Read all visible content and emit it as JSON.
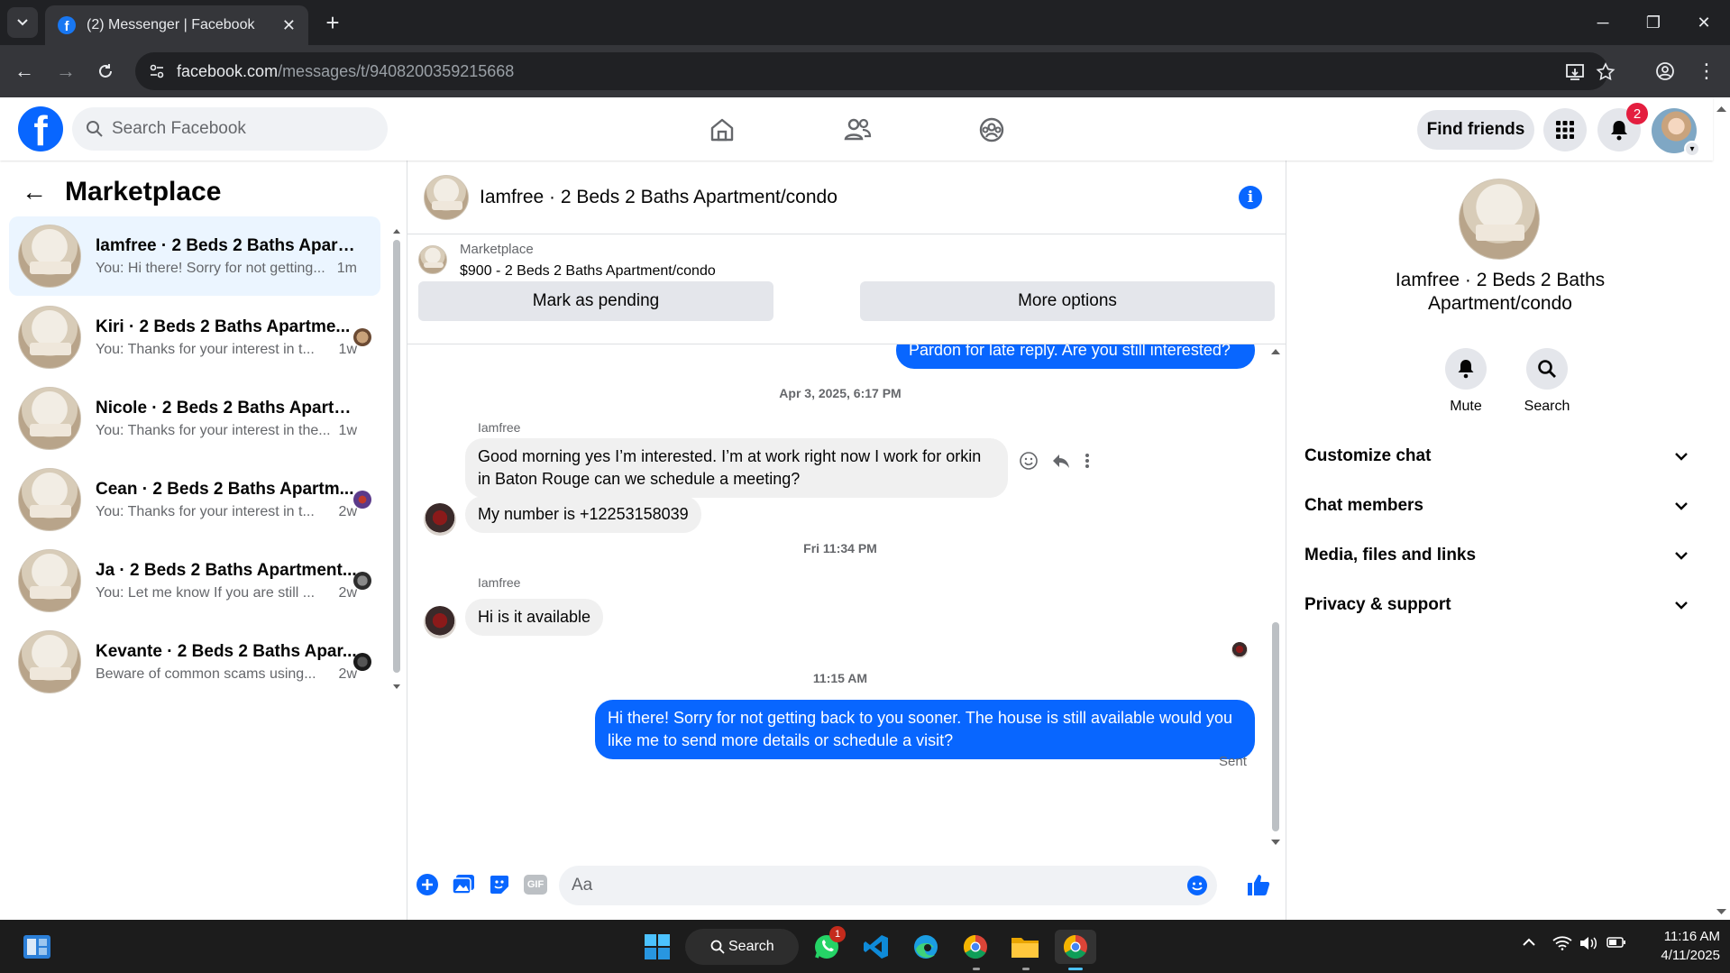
{
  "browser": {
    "tab_title": "(2) Messenger | Facebook",
    "url_domain": "facebook.com",
    "url_path": "/messages/t/9408200359215668"
  },
  "fb_header": {
    "search_placeholder": "Search Facebook",
    "find_friends": "Find friends",
    "notification_count": "2"
  },
  "sidebar": {
    "title": "Marketplace",
    "conversations": [
      {
        "name": "Iamfree · 2 Beds 2 Baths Apartm...",
        "snippet": "You: Hi there! Sorry for not getting...",
        "time": "1m",
        "active": true
      },
      {
        "name": "Kiri · 2 Beds 2 Baths Apartme...",
        "snippet": "You: Thanks for your interest in t...",
        "time": "1w"
      },
      {
        "name": "Nicole · 2 Beds 2 Baths Apartme...",
        "snippet": "You: Thanks for your interest in the...",
        "time": "1w"
      },
      {
        "name": "Cean · 2 Beds 2 Baths Apartm...",
        "snippet": "You: Thanks for your interest in t...",
        "time": "2w"
      },
      {
        "name": "Ja · 2 Beds 2 Baths Apartment...",
        "snippet": "You: Let me know If you are still ...",
        "time": "2w"
      },
      {
        "name": "Kevante · 2 Beds 2 Baths Apar...",
        "snippet": "Beware of common scams using...",
        "time": "2w"
      }
    ]
  },
  "chat": {
    "title": "Iamfree · 2 Beds 2 Baths Apartment/condo",
    "marketplace_label": "Marketplace",
    "listing": "$900 - 2 Beds 2 Baths Apartment/condo",
    "mark_pending": "Mark as pending",
    "more_options": "More options",
    "messages": {
      "partial_out": "Pardon for late reply. Are you still interested?",
      "ts1": "Apr 3, 2025, 6:17 PM",
      "sender1": "Iamfree",
      "m1": "Good morning yes I’m interested. I’m at work right now I work for orkin in Baton Rouge can we schedule a meeting?",
      "m2": "My number is +12253158039",
      "ts2": "Fri 11:34 PM",
      "sender2": "Iamfree",
      "m3": "Hi is it available",
      "ts3": "11:15 AM",
      "m4": "Hi there! Sorry for not getting back to you sooner. The house is still available would you like me to send more details or schedule a visit?",
      "status": "Sent"
    },
    "composer_placeholder": "Aa",
    "gif_label": "GIF"
  },
  "details": {
    "name": "Iamfree · 2 Beds 2 Baths Apartment/condo",
    "mute": "Mute",
    "search": "Search",
    "sections": [
      "Customize chat",
      "Chat members",
      "Media, files and links",
      "Privacy & support"
    ]
  },
  "taskbar": {
    "search": "Search",
    "whatsapp_badge": "1",
    "time": "11:16 AM",
    "date": "4/11/2025"
  },
  "colors": {
    "accent": "#0866ff",
    "active_conv": "#ebf5ff",
    "badge": "#e41e3f"
  }
}
